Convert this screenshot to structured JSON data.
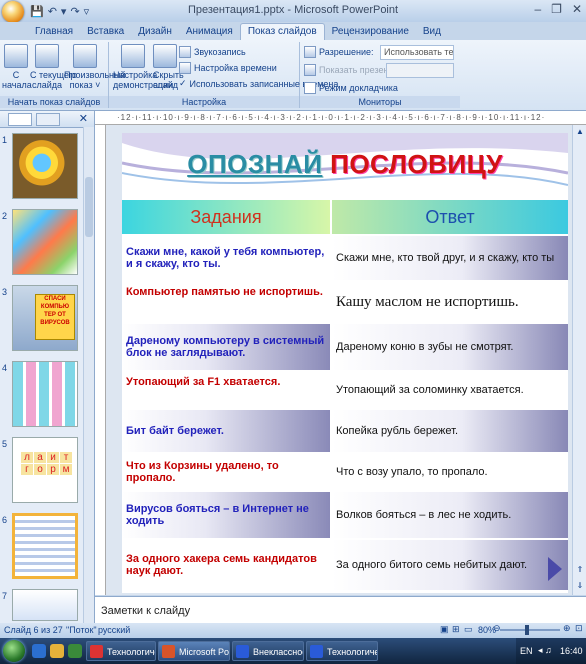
{
  "window": {
    "title": "Презентация1.pptx - Microsoft PowerPoint"
  },
  "ribbon_tabs": [
    "Главная",
    "Вставка",
    "Дизайн",
    "Анимация",
    "Показ слайдов",
    "Рецензирование",
    "Вид"
  ],
  "active_tab": "Показ слайдов",
  "ribbon": {
    "group1": {
      "label": "Начать показ слайдов",
      "btn1": "С\nначала",
      "btn2": "С текущего\nслайда",
      "btn3": "Произвольный\nпоказ ˅"
    },
    "group2": {
      "label": "Настройка",
      "btn1": "Настройка\nдемонстрации",
      "btn2": "Скрыть\nслайд",
      "rows": [
        "Звукозапись",
        "Настройка времени",
        "Использовать записанные времена"
      ]
    },
    "group3": {
      "label": "Мониторы",
      "resolution_label": "Разрешение:",
      "resolution_value": "Использовать теку...",
      "show_on_label": "Показать презентацию на:",
      "presenter_view": "Режим докладчика"
    }
  },
  "ruler_text": "·12·ı·11·ı·10·ı·9·ı·8·ı·7·ı·6·ı·5·ı·4·ı·3·ı·2·ı·1·ı·0·ı·1·ı·2·ı·3·ı·4·ı·5·ı·6·ı·7·ı·8·ı·9·ı·10·ı·11·ı·12·",
  "slides_panel": {
    "slide_numbers": [
      "1",
      "2",
      "3",
      "4",
      "5",
      "6",
      "7"
    ],
    "slide5_letters": [
      "л",
      "а",
      "и",
      "т",
      "г",
      "о",
      "р",
      "м"
    ],
    "slide3_text": "СПАСИ КОМПЬЮ ТЕР ОТ ВИРУСОВ"
  },
  "slide": {
    "title_part1": "ОПОЗНАЙ",
    "title_part2": "ПОСЛОВИЦУ",
    "header_left": "Задания",
    "header_right": "Ответ",
    "rows": [
      {
        "task": "Скажи мне, какой у тебя компьютер, и я скажу, кто ты.",
        "answer": "Скажи мне, кто твой друг, и я скажу, кто ты"
      },
      {
        "task": "Компьютер памятью не испортишь.",
        "answer": "Кашу маслом не испортишь."
      },
      {
        "task": "Дареному компьютеру в системный блок не заглядывают.",
        "answer": "Дареному коню в зубы не смотрят."
      },
      {
        "task": "Утопающий за F1 хватается.",
        "answer": "Утопающий за соломинку хватается."
      },
      {
        "task": "Бит байт бережет.",
        "answer": "Копейка рубль бережет."
      },
      {
        "task": "Что из Корзины удалено, то пропало.",
        "answer": "Что с возу упало, то пропало."
      },
      {
        "task": "Вирусов бояться – в Интернет не ходить",
        "answer": "Волков бояться – в лес не ходить."
      },
      {
        "task": "За одного хакера семь кандидатов наук дают.",
        "answer": "За одного битого семь небитых дают."
      }
    ]
  },
  "notes_placeholder": "Заметки к слайду",
  "status": {
    "slide_info": "Слайд 6 из 27",
    "theme": "\"Поток\"",
    "language": "русский",
    "zoom": "80%"
  },
  "taskbar": {
    "tasks": [
      "Технологическ...",
      "Microsoft Powe...",
      "Внеклассное м...",
      "Технологическ..."
    ],
    "lang": "EN",
    "time": "16:40"
  }
}
